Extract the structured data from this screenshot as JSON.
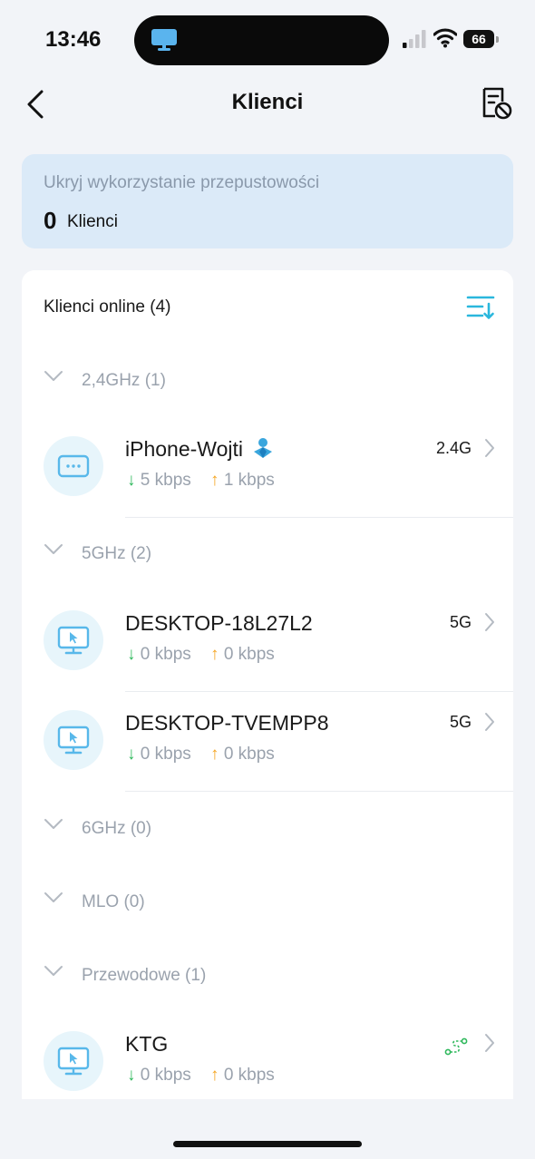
{
  "status_bar": {
    "time": "13:46",
    "battery": "66"
  },
  "nav": {
    "title": "Klienci"
  },
  "bandwidth_card": {
    "label": "Ukryj wykorzystanie przepustowości",
    "count": "0",
    "unit": "Klienci"
  },
  "clients_section": {
    "title": "Klienci online (4)",
    "groups": [
      {
        "label": "2,4GHz (1)"
      },
      {
        "label": "5GHz (2)"
      },
      {
        "label": "6GHz (0)"
      },
      {
        "label": "MLO (0)"
      },
      {
        "label": "Przewodowe (1)"
      }
    ],
    "clients": [
      {
        "name": "iPhone-Wojti",
        "down": "5 kbps",
        "up": "1 kbps",
        "band": "2.4G",
        "icon": "phone-icon"
      },
      {
        "name": "DESKTOP-18L27L2",
        "down": "0 kbps",
        "up": "0 kbps",
        "band": "5G",
        "icon": "desktop-icon"
      },
      {
        "name": "DESKTOP-TVEMPP8",
        "down": "0 kbps",
        "up": "0 kbps",
        "band": "5G",
        "icon": "desktop-icon"
      },
      {
        "name": "KTG",
        "down": "0 kbps",
        "up": "0 kbps",
        "band": "",
        "icon": "desktop-icon"
      }
    ]
  },
  "arrows": {
    "down": "↓",
    "up": "↑"
  },
  "colors": {
    "accent": "#2ab7dd",
    "download": "#2fb85c",
    "upload": "#f5a623",
    "card_bg": "#dbeaf8"
  }
}
